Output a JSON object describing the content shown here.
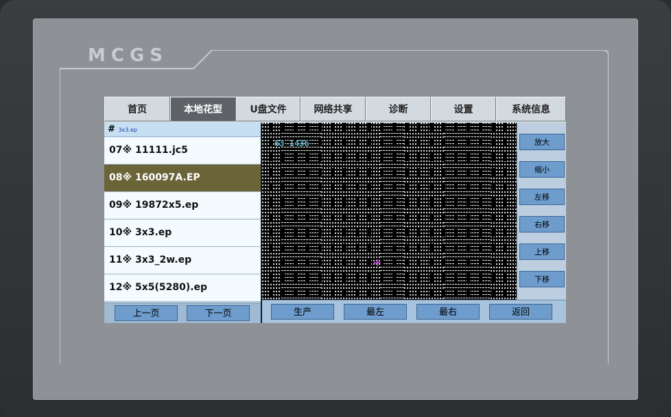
{
  "brand": "MCGS",
  "tabs": [
    "首页",
    "本地花型",
    "U盘文件",
    "网络共享",
    "诊断",
    "设置",
    "系统信息"
  ],
  "active_tab": "本地花型",
  "path": {
    "hash": "#",
    "file": "3x3.ep"
  },
  "files": [
    "07※ 11111.jc5",
    "08※ 160097A.EP",
    "09※ 19872x5.ep",
    "10※ 3x3.ep",
    "11※ 3x3_2w.ep",
    "12※ 5x5(5280).ep"
  ],
  "active_file_index": 1,
  "pager": {
    "prev": "上一页",
    "next": "下一页"
  },
  "view_buttons": [
    "放大",
    "缩小",
    "左移",
    "右移",
    "上移",
    "下移"
  ],
  "bottom_buttons": [
    "生产",
    "最左",
    "最右",
    "返回"
  ],
  "coordinate_readout": "63  1436",
  "colors": {
    "accent_tab": "#5e6266",
    "selected_row": "#6b6439",
    "button": "#6d9ccd"
  }
}
